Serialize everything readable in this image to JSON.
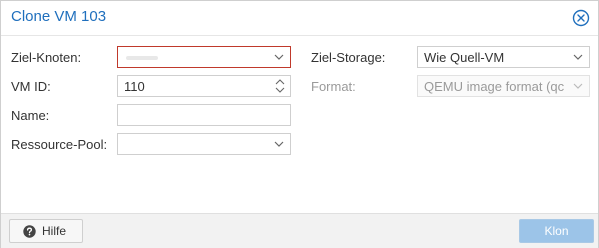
{
  "dialog": {
    "title": "Clone VM 103"
  },
  "form": {
    "target_node": {
      "label": "Ziel-Knoten:",
      "value": ""
    },
    "vm_id": {
      "label": "VM ID:",
      "value": "110"
    },
    "name": {
      "label": "Name:",
      "value": ""
    },
    "resource_pool": {
      "label": "Ressource-Pool:",
      "value": ""
    },
    "target_storage": {
      "label": "Ziel-Storage:",
      "value": "Wie Quell-VM"
    },
    "format": {
      "label": "Format:",
      "value": "QEMU image format (qc"
    }
  },
  "footer": {
    "help_label": "Hilfe",
    "clone_label": "Klon"
  },
  "colors": {
    "title": "#1f6fbd",
    "invalid_border": "#c0392b",
    "primary_button": "#9cc4e8"
  }
}
